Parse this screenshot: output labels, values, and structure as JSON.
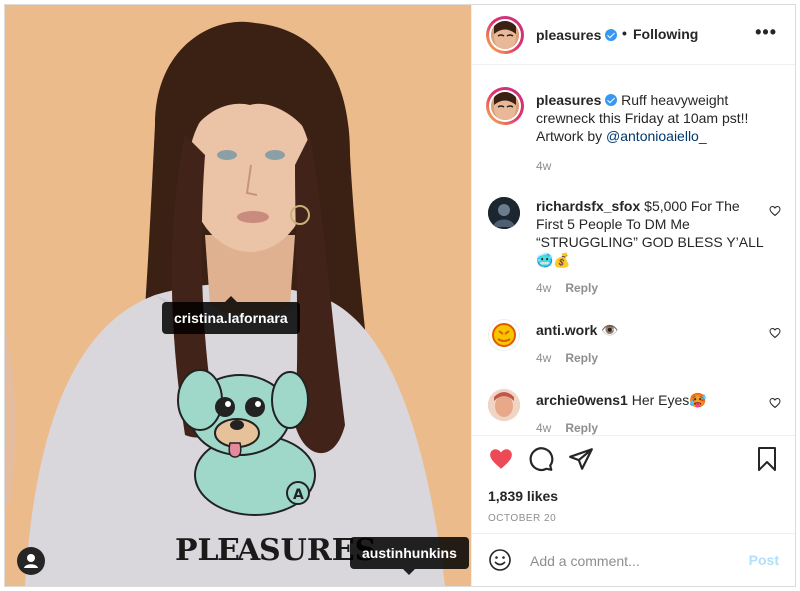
{
  "photo": {
    "tags": [
      {
        "username": "cristina.lafornara"
      },
      {
        "username": "austinhunkins"
      }
    ],
    "sweatshirt_print": "PLEASURES",
    "user_tags_icon": "person-icon"
  },
  "header": {
    "username": "pleasures",
    "separator": "•",
    "follow_status": "Following",
    "more_label": "•••"
  },
  "caption": {
    "username": "pleasures",
    "text_before": "Ruff heavyweight crewneck this Friday at 10am pst!! Artwork by ",
    "mention": "@antonioaiello_",
    "time": "4w"
  },
  "comments": [
    {
      "username": "richardsfx_sfox",
      "text": "$5,000 For The First 5 People To DM Me “STRUGGLING” GOD BLESS Y’ALL 🥶💰",
      "time": "4w",
      "reply": "Reply"
    },
    {
      "username": "anti.work",
      "text": "👁️",
      "time": "4w",
      "reply": "Reply"
    },
    {
      "username": "archie0wens1",
      "text": "Her Eyes🥵",
      "time": "4w",
      "reply": "Reply"
    }
  ],
  "actions": {
    "likes": "1,839 likes",
    "date": "OCTOBER 20",
    "like_color": "#ed4956"
  },
  "add_comment": {
    "placeholder": "Add a comment...",
    "post_label": "Post"
  },
  "colors": {
    "accent": "#3897f0",
    "post_disabled": "#b2dffc",
    "background_photo": "#ebb98a"
  }
}
